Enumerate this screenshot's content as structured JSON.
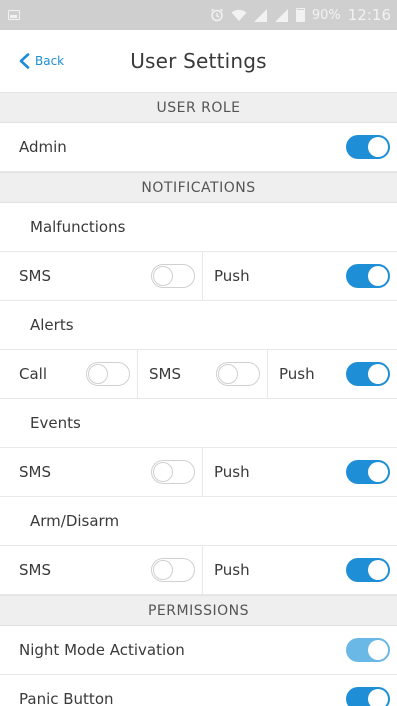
{
  "status_bar": {
    "battery": "90%",
    "time": "12:16"
  },
  "nav": {
    "back_label": "Back",
    "title": "User Settings"
  },
  "user_role": {
    "header": "USER ROLE",
    "admin": {
      "label": "Admin",
      "on": true
    }
  },
  "notifications": {
    "header": "NOTIFICATIONS",
    "malfunctions": {
      "title": "Malfunctions",
      "sms_label": "SMS",
      "sms_on": false,
      "push_label": "Push",
      "push_on": true
    },
    "alerts": {
      "title": "Alerts",
      "call_label": "Call",
      "call_on": false,
      "sms_label": "SMS",
      "sms_on": false,
      "push_label": "Push",
      "push_on": true
    },
    "events": {
      "title": "Events",
      "sms_label": "SMS",
      "sms_on": false,
      "push_label": "Push",
      "push_on": true
    },
    "arm_disarm": {
      "title": "Arm/Disarm",
      "sms_label": "SMS",
      "sms_on": false,
      "push_label": "Push",
      "push_on": true
    }
  },
  "permissions": {
    "header": "PERMISSIONS",
    "night_mode": {
      "label": "Night Mode Activation",
      "on": true
    },
    "panic_button": {
      "label": "Panic Button",
      "on": true
    }
  },
  "colors": {
    "accent": "#1e8ed6",
    "accent_light": "#6ab8e6",
    "header_bg": "#efefef",
    "status_bar_bg": "#cfcfcf"
  }
}
